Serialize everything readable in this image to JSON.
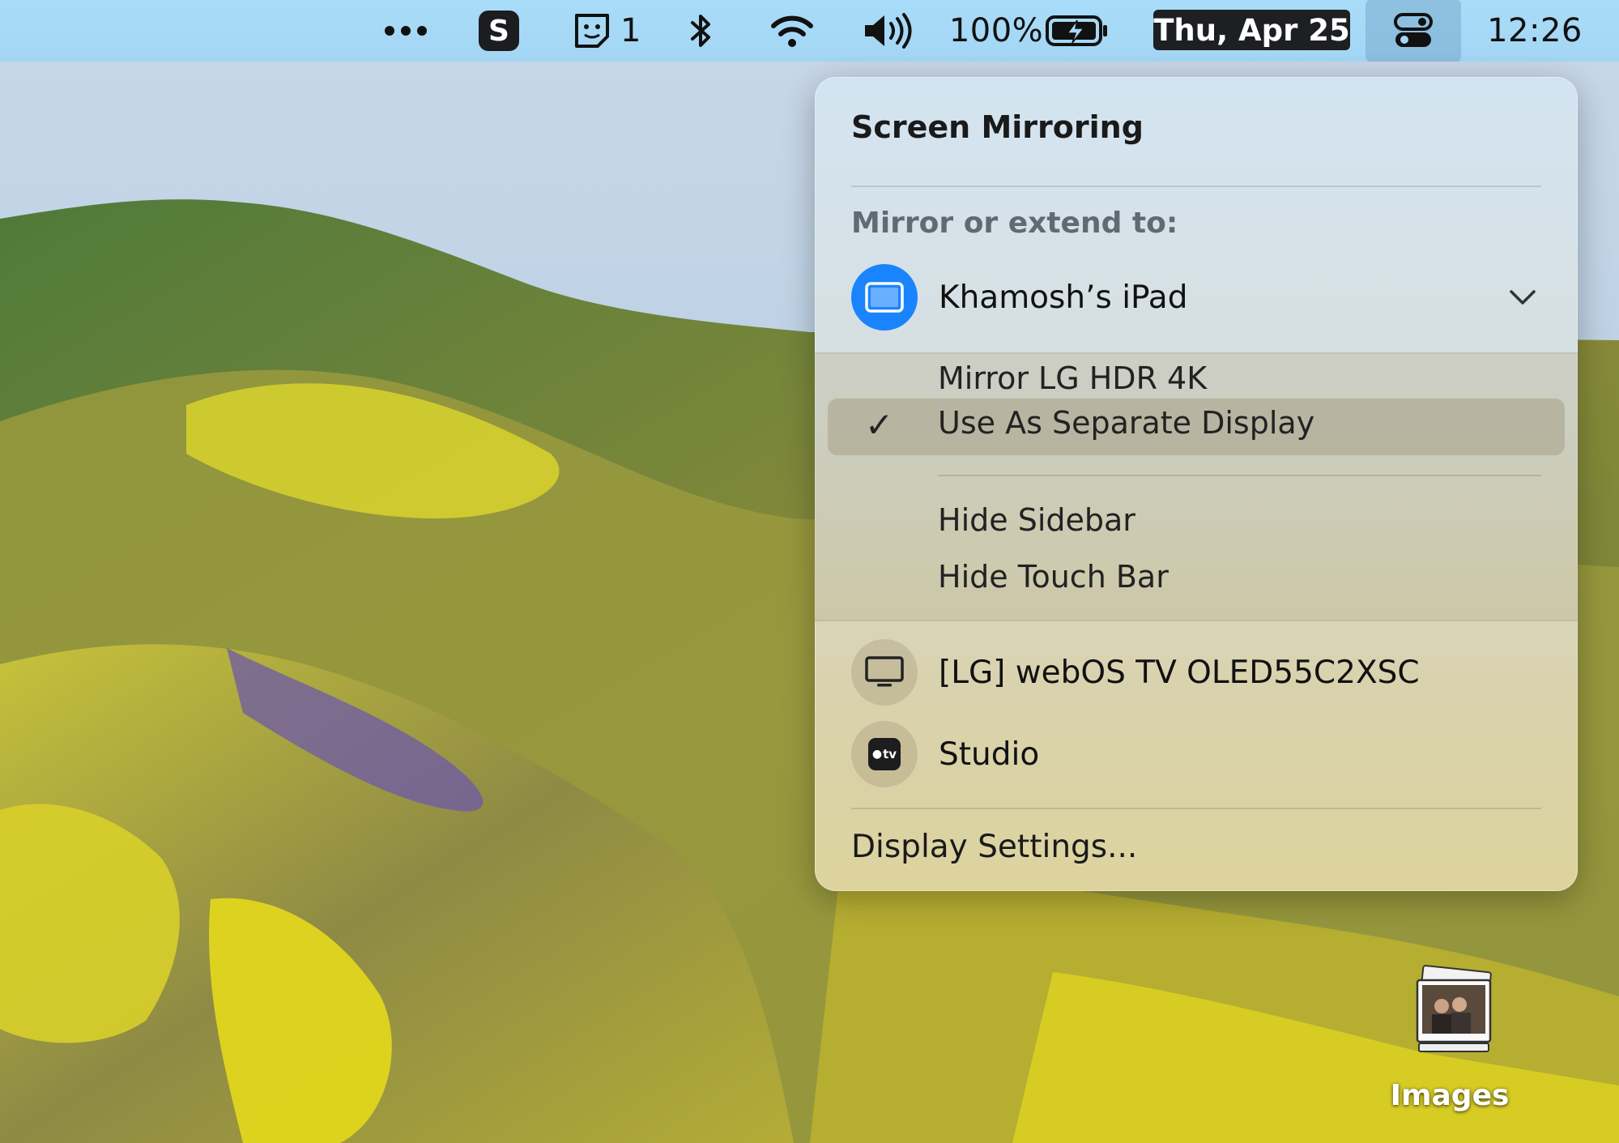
{
  "menubar": {
    "overflow_icon": "ellipsis-icon",
    "skype_label": "S",
    "notes_count": "1",
    "bluetooth_icon": "bluetooth-icon",
    "wifi_icon": "wifi-icon",
    "volume_icon": "volume-icon",
    "battery_percent": "100%",
    "battery_icon": "battery-charging-icon",
    "date": "Thu, Apr 25",
    "control_center_icon": "control-center-icon",
    "time": "12:26"
  },
  "panel": {
    "title": "Screen Mirroring",
    "section_label": "Mirror or extend to:",
    "selected_device": {
      "label": "Khamosh’s iPad",
      "icon": "ipad-icon",
      "accent_color": "#1a84ff"
    },
    "submenu": {
      "items": [
        {
          "label": "Mirror LG HDR 4K",
          "checked": false
        },
        {
          "label": "Use As Separate Display",
          "checked": true
        },
        {
          "label": "Hide Sidebar",
          "checked": false
        },
        {
          "label": "Hide Touch Bar",
          "checked": false
        }
      ],
      "check_glyph": "✓"
    },
    "other_devices": [
      {
        "label": "[LG] webOS TV OLED55C2XSC",
        "icon": "tv-icon"
      },
      {
        "label": "Studio",
        "icon": "apple-tv-icon",
        "icon_text": "tv"
      }
    ],
    "footer_link": "Display Settings..."
  },
  "desktop": {
    "icon_label": "Images"
  }
}
